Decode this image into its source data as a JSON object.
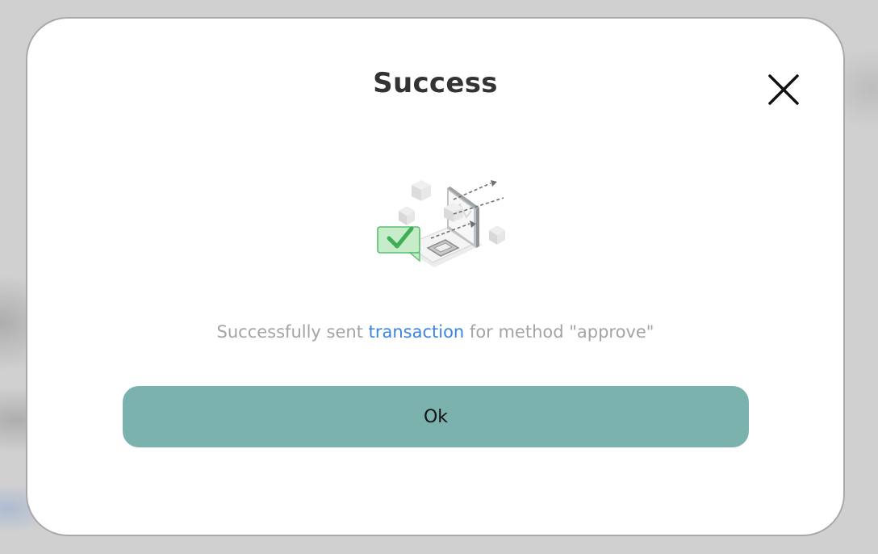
{
  "modal": {
    "title": "Success",
    "message_prefix": "Successfully sent ",
    "message_link": "transaction",
    "message_suffix": " for method \"approve\"",
    "ok_label": "Ok"
  },
  "icons": {
    "close": "close-icon",
    "illustration": "transaction-sent-illustration"
  },
  "colors": {
    "button": "#7bb2ae",
    "link": "#3b84e0",
    "message": "#a3a3a8",
    "title": "#333333",
    "check": "#5bbf6e"
  }
}
